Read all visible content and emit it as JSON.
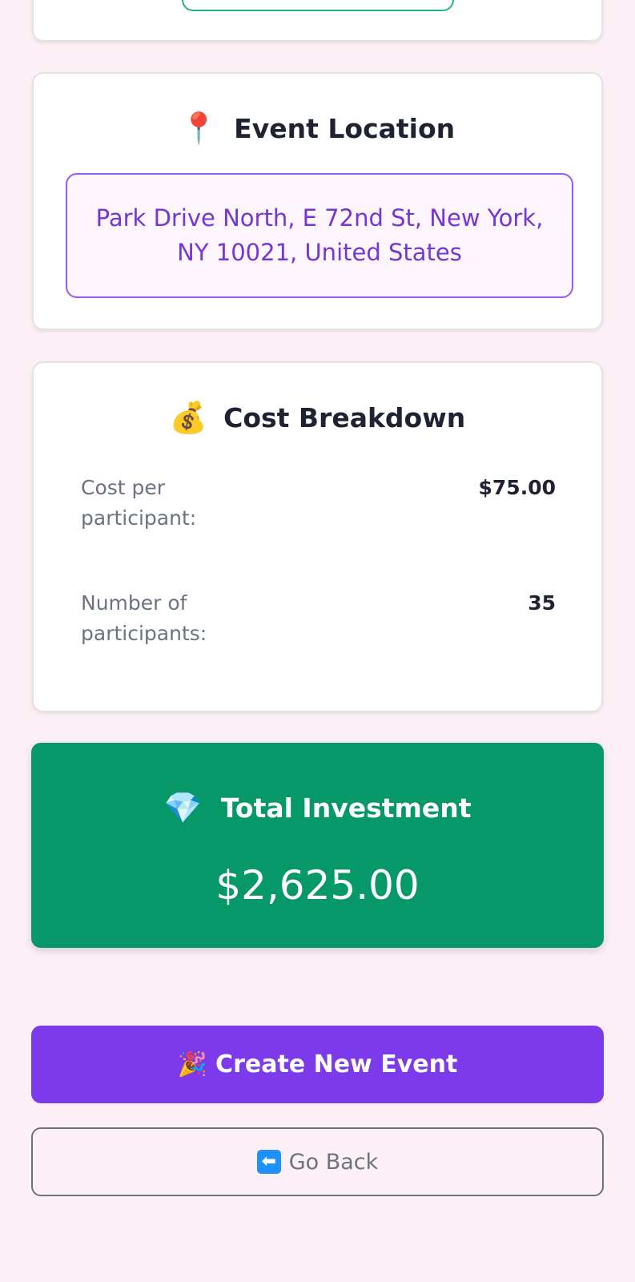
{
  "location": {
    "icon": "📍",
    "title": "Event Location",
    "address": "Park Drive North, E 72nd St, New York, NY 10021, United States"
  },
  "cost": {
    "icon": "💰",
    "title": "Cost Breakdown",
    "rows": [
      {
        "label": "Cost per participant:",
        "value": "$75.00"
      },
      {
        "label": "Number of participants:",
        "value": "35"
      }
    ]
  },
  "total": {
    "icon": "💎",
    "title": "Total Investment",
    "amount": "$2,625.00"
  },
  "actions": {
    "create_icon": "🎉",
    "create_label": "Create New Event",
    "back_icon": "⬅",
    "back_label": "Go Back"
  },
  "colors": {
    "background": "#fcf0f6",
    "accent_purple": "#7c3aea",
    "total_green": "#069869"
  }
}
